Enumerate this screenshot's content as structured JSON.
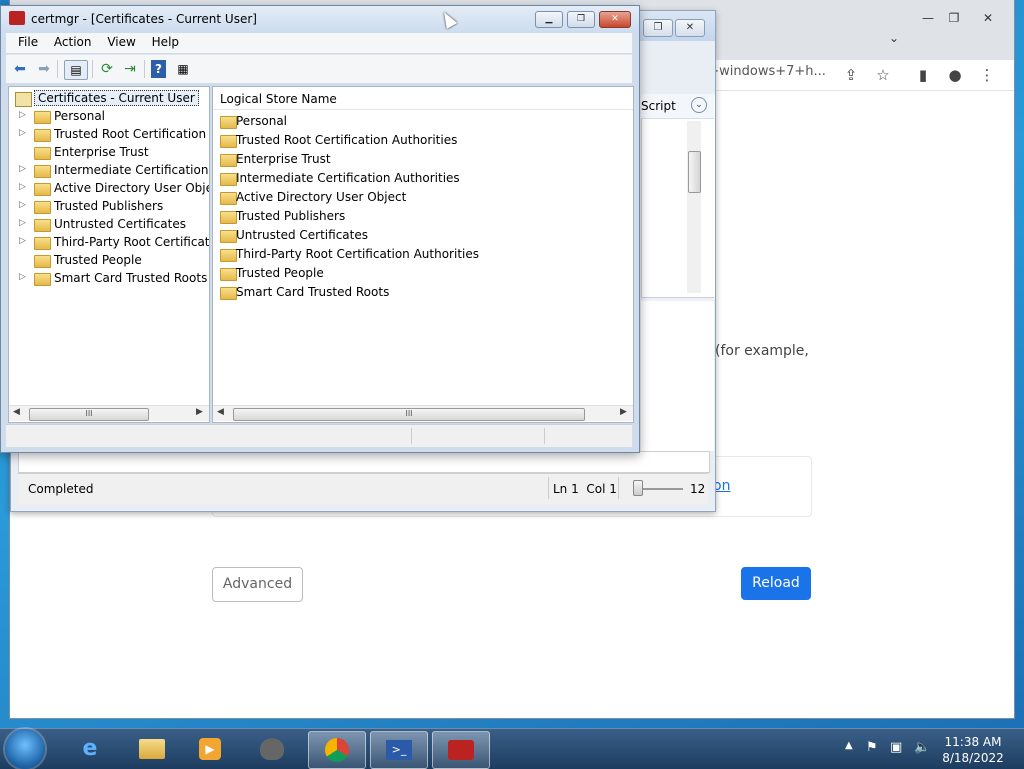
{
  "browser": {
    "omnibox_fragment": "n+windows+7+h...",
    "page_text_fragment": "(for example,",
    "link_fragment": "on",
    "advanced_label": "Advanced",
    "reload_label": "Reload"
  },
  "ise": {
    "script_label": "Script",
    "status_text": "Completed",
    "ln_col": "Ln 1  Col 1",
    "zoom": "12"
  },
  "certmgr": {
    "title": "certmgr - [Certificates - Current User]",
    "menu": [
      "File",
      "Action",
      "View",
      "Help"
    ],
    "tree_root": "Certificates - Current User",
    "tree_items": [
      {
        "label": "Personal",
        "expandable": true
      },
      {
        "label": "Trusted Root Certification Au",
        "expandable": true
      },
      {
        "label": "Enterprise Trust",
        "expandable": false
      },
      {
        "label": "Intermediate Certification Au",
        "expandable": true
      },
      {
        "label": "Active Directory User Object",
        "expandable": true
      },
      {
        "label": "Trusted Publishers",
        "expandable": true
      },
      {
        "label": "Untrusted Certificates",
        "expandable": true
      },
      {
        "label": "Third-Party Root Certificatior",
        "expandable": true
      },
      {
        "label": "Trusted People",
        "expandable": false
      },
      {
        "label": "Smart Card Trusted Roots",
        "expandable": true
      }
    ],
    "list_header": "Logical Store Name",
    "list_items": [
      "Personal",
      "Trusted Root Certification Authorities",
      "Enterprise Trust",
      "Intermediate Certification Authorities",
      "Active Directory User Object",
      "Trusted Publishers",
      "Untrusted Certificates",
      "Third-Party Root Certification Authorities",
      "Trusted People",
      "Smart Card Trusted Roots"
    ]
  },
  "taskbar": {
    "time": "11:38 AM",
    "date": "8/18/2022"
  }
}
